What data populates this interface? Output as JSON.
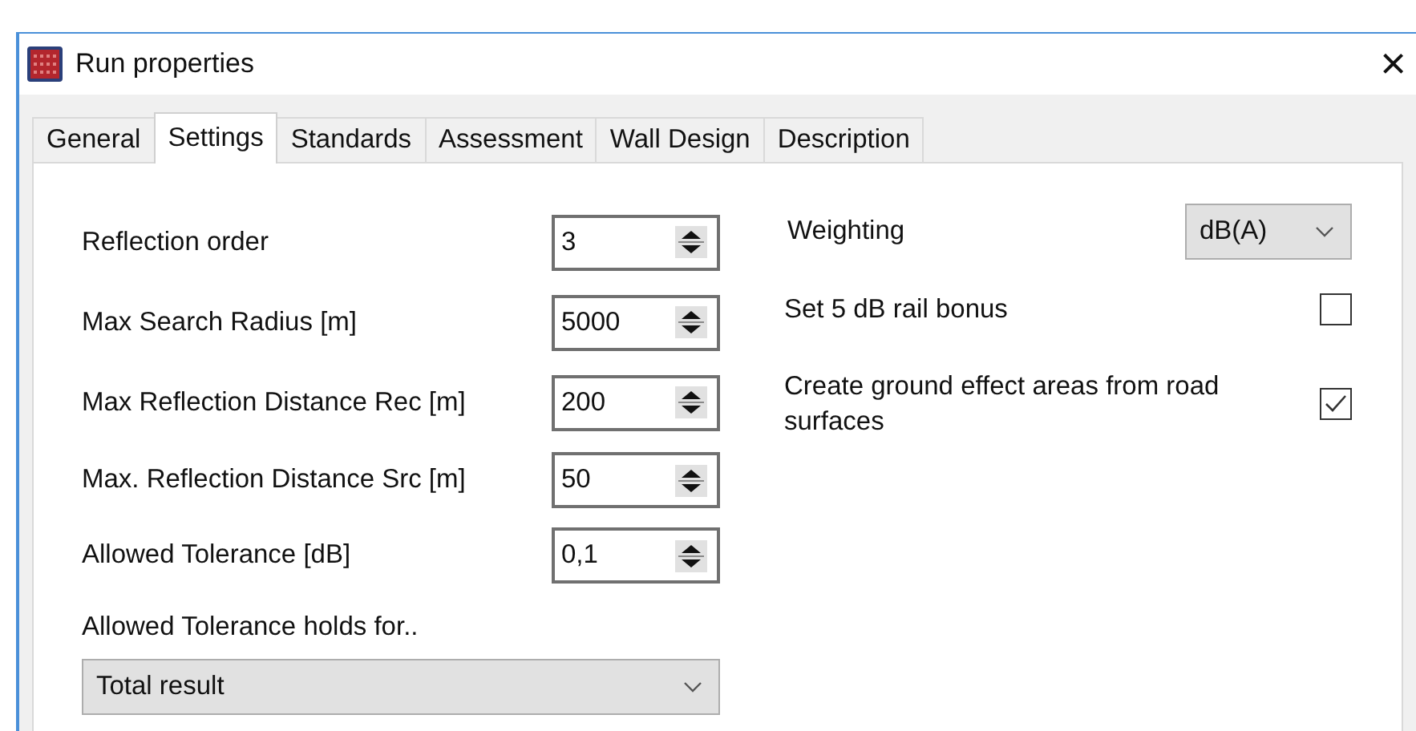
{
  "window": {
    "title": "Run properties",
    "close": "×"
  },
  "tabs": [
    {
      "label": "General",
      "selected": false
    },
    {
      "label": "Settings",
      "selected": true
    },
    {
      "label": "Standards",
      "selected": false
    },
    {
      "label": "Assessment",
      "selected": false
    },
    {
      "label": "Wall Design",
      "selected": false
    },
    {
      "label": "Description",
      "selected": false
    }
  ],
  "fields": [
    {
      "label": "Reflection order",
      "value": "3"
    },
    {
      "label": "Max Search Radius [m]",
      "value": "5000"
    },
    {
      "label": "Max Reflection Distance Rec [m]",
      "value": "200"
    },
    {
      "label": "Max. Reflection Distance Src [m]",
      "value": "50"
    },
    {
      "label": "Allowed Tolerance [dB]",
      "value": "0,1"
    }
  ],
  "tolerance_scope": {
    "label": "Allowed Tolerance holds for..",
    "value": "Total result"
  },
  "weighting": {
    "label": "Weighting",
    "value": "dB(A)"
  },
  "options": [
    {
      "label": "Set 5 dB rail bonus",
      "checked": false
    },
    {
      "label": "Create ground effect areas from road surfaces",
      "checked": true
    }
  ]
}
